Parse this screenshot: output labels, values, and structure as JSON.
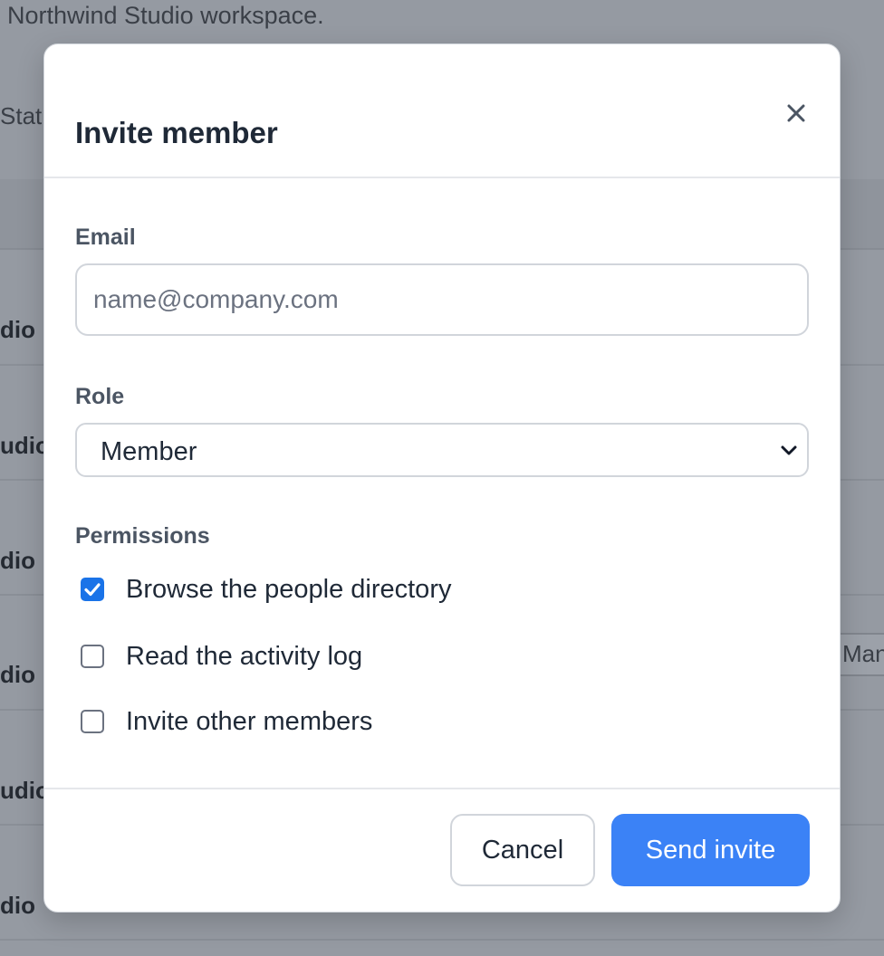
{
  "background": {
    "subtitle": "Northwind Studio workspace.",
    "header_cell": "Stat",
    "row_cells": [
      "dio",
      "udio",
      "dio",
      "dio",
      "udio",
      "dio"
    ],
    "row_select_partial": "Man"
  },
  "modal": {
    "title": "Invite member",
    "close_label": "×",
    "email": {
      "label": "Email",
      "placeholder": "name@company.com",
      "value": ""
    },
    "role": {
      "label": "Role",
      "selected": "Member"
    },
    "permissions": {
      "label": "Permissions",
      "items": [
        {
          "label": "Browse the people directory",
          "checked": true
        },
        {
          "label": "Read the activity log",
          "checked": false
        },
        {
          "label": "Invite other members",
          "checked": false
        }
      ]
    },
    "buttons": {
      "cancel": "Cancel",
      "send": "Send invite"
    }
  },
  "colors": {
    "accent": "#3b82f6",
    "checkbox_checked": "#1a73e8",
    "overlay": "#959aa2"
  },
  "icons": {
    "close": "close-icon",
    "select": "chevron-down-icon",
    "check": "check-icon"
  }
}
